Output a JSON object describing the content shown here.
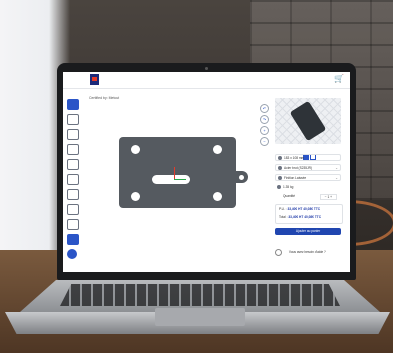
{
  "app": {
    "breadcrumb": "Certified by: Metcut",
    "cart_icon": "cart-icon"
  },
  "configurator": {
    "dimensions": "183 x 108 mm",
    "material": "Acier brut (S235JR)",
    "finish": "Finition Laissée",
    "weight": "1.35 kg",
    "quantity_label": "Quantité",
    "quantity_value": "1",
    "price_unit_label": "P.U. :",
    "price_unit": "33,40€ HT",
    "price_unit_ttc": "40,08€ TTC",
    "price_total_label": "Total :",
    "price_total": "33,40€ HT",
    "price_total_ttc": "40,08€ TTC",
    "add_to_cart": "Ajouter au panier",
    "help": "Vous avez besoin d'aide ?"
  },
  "colors": {
    "accent": "#2046b0",
    "part": "#555a60"
  }
}
